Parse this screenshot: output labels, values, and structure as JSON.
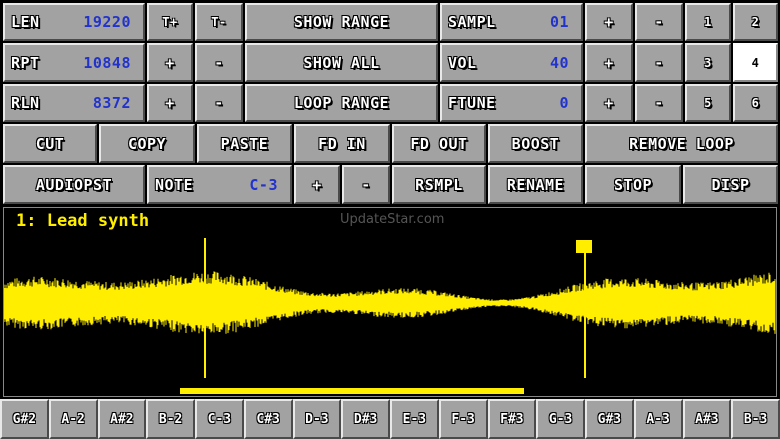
{
  "params": {
    "len": {
      "label": "LEN",
      "value": "19220"
    },
    "rpt": {
      "label": "RPT",
      "value": "10848"
    },
    "rln": {
      "label": "RLN",
      "value": "8372"
    },
    "sampl": {
      "label": "SAMPL",
      "value": "01"
    },
    "vol": {
      "label": "VOL",
      "value": "40"
    },
    "ftune": {
      "label": "FTUNE",
      "value": "0"
    },
    "note": {
      "label": "NOTE",
      "value": "C-3"
    }
  },
  "buttons": {
    "t_plus": "T+",
    "t_minus": "T-",
    "plus": "+",
    "minus": "-",
    "show_range": "SHOW RANGE",
    "show_all": "SHOW ALL",
    "loop_range": "LOOP RANGE",
    "cut": "CUT",
    "copy": "COPY",
    "paste": "PASTE",
    "fd_in": "FD IN",
    "fd_out": "FD OUT",
    "boost": "BOOST",
    "remove_loop": "REMOVE LOOP",
    "audiopst": "AUDIOPST",
    "rsmpl": "RSMPL",
    "rename": "RENAME",
    "stop": "STOP",
    "disp": "DISP"
  },
  "pages": [
    "1",
    "2",
    "3",
    "4",
    "5",
    "6"
  ],
  "selected_page": "4",
  "sample_title": "1: Lead synth",
  "watermark": "UpdateStar.com",
  "keys": [
    "G#2",
    "A-2",
    "A#2",
    "B-2",
    "C-3",
    "C#3",
    "D-3",
    "D#3",
    "E-3",
    "F-3",
    "F#3",
    "G-3",
    "G#3",
    "A-3",
    "A#3",
    "B-3"
  ],
  "colors": {
    "waveform": "#ffee00",
    "value": "#2233cc",
    "button": "#a2a2a2"
  }
}
